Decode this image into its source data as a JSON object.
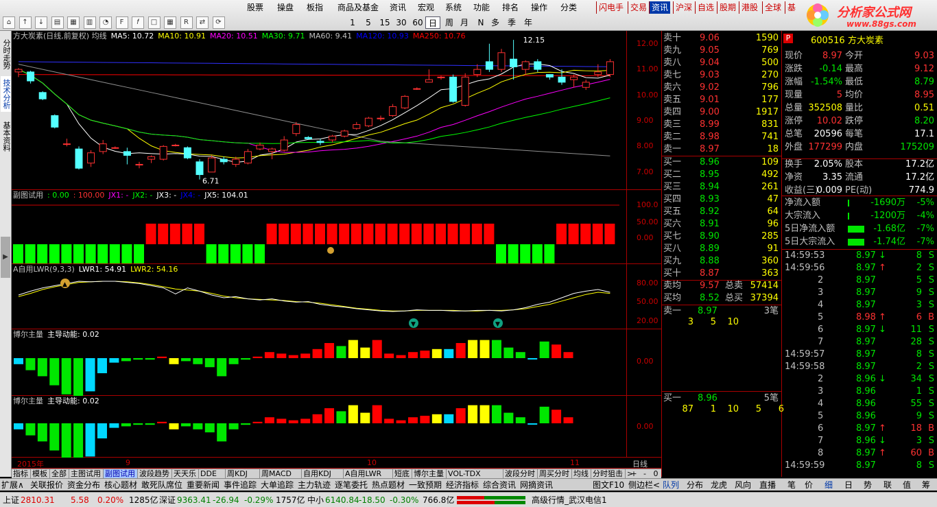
{
  "menu": [
    "股票",
    "操盘",
    "板指",
    "商品及基金",
    "资讯",
    "宏观",
    "系统",
    "功能",
    "排名",
    "操作",
    "分类"
  ],
  "periods": [
    "1",
    "5",
    "15",
    "30",
    "60",
    "日",
    "周",
    "月",
    "N",
    "多",
    "季",
    "年"
  ],
  "active_period": "日",
  "top_right_menu": [
    "闪电手",
    "交易",
    "资讯",
    "沪深",
    "自选",
    "股期",
    "港股",
    "全球",
    "基"
  ],
  "top_right_highlight": "资讯",
  "logo": {
    "title": "分析家公式网",
    "url": "www.88gs.com"
  },
  "left_tabs": [
    "分时走势",
    "技术分析",
    "基本资料"
  ],
  "main_panel": {
    "header": "方大炭素(日线,前复权) 均线",
    "ma": [
      {
        "label": "MA5: 10.72",
        "color": "#ffffff"
      },
      {
        "label": "MA10: 10.91",
        "color": "#ffff00"
      },
      {
        "label": "MA20: 10.51",
        "color": "#ff00ff"
      },
      {
        "label": "MA30: 9.71",
        "color": "#00ff00"
      },
      {
        "label": "MA60: 9.41",
        "color": "#c0c0c0"
      },
      {
        "label": "MA120: 10.93",
        "color": "#0000ff"
      },
      {
        "label": "MA250: 10.76",
        "color": "#ff0000"
      }
    ],
    "y_ticks": [
      "12.00",
      "11.00",
      "10.00",
      "9.00",
      "8.00",
      "7.00"
    ],
    "high_label": "12.15",
    "low_label": "6.71"
  },
  "sub1": {
    "header": "副图试用",
    "vals": [
      {
        "t": ": 0.00",
        "c": "#00ff00"
      },
      {
        "t": ": 100.00",
        "c": "#ff3232"
      },
      {
        "t": "JX1: -",
        "c": "#ff00ff"
      },
      {
        "t": "JX2: -",
        "c": "#00ff00"
      },
      {
        "t": "JX3: -",
        "c": "#ffffff"
      },
      {
        "t": "JX4: -",
        "c": "#0000ff"
      },
      {
        "t": "JX5: 104.01",
        "c": "#ffffff"
      }
    ],
    "y_ticks": [
      "100.0",
      "50.00",
      "0.00"
    ]
  },
  "sub2": {
    "header": "A自用LWR(9,3,3)",
    "vals": [
      {
        "t": "LWR1: 54.91",
        "c": "#ffffff"
      },
      {
        "t": "LWR2: 54.16",
        "c": "#ffff00"
      }
    ],
    "y_ticks": [
      "80.00",
      "50.00",
      "20.00"
    ]
  },
  "sub3": {
    "header": "博尔主量",
    "vals": [
      {
        "t": "主导动能: 0.02",
        "c": "#ffffff"
      }
    ],
    "y_ticks": [
      "0.00"
    ]
  },
  "sub4": {
    "header": "博尔主量",
    "vals": [
      {
        "t": "主导动能: 0.02",
        "c": "#ffffff"
      }
    ],
    "y_ticks": [
      "0.00"
    ]
  },
  "x_axis": {
    "labels": [
      "2015年",
      "9",
      "10",
      "11"
    ],
    "right": "日线"
  },
  "bottom_tabs": [
    "指标",
    "模板",
    "全部",
    "主图试用",
    "副图试用",
    "波段趋势",
    "天天乐",
    "DDE",
    "周KDJ",
    "周MACD",
    "自用KDJ",
    "A自用LWR",
    "短底",
    "博尔主量",
    "VOL-TDX",
    "波段分时",
    "周买分时",
    "均线",
    "分时狙击"
  ],
  "bottom_tab_active": "副图试用",
  "zoom": [
    "+",
    "-",
    "0"
  ],
  "orderbook": {
    "sells": [
      {
        "l": "卖十",
        "p": "9.06",
        "v": "1590"
      },
      {
        "l": "卖九",
        "p": "9.05",
        "v": "769"
      },
      {
        "l": "卖八",
        "p": "9.04",
        "v": "500"
      },
      {
        "l": "卖七",
        "p": "9.03",
        "v": "270"
      },
      {
        "l": "卖六",
        "p": "9.02",
        "v": "796"
      },
      {
        "l": "卖五",
        "p": "9.01",
        "v": "177"
      },
      {
        "l": "卖四",
        "p": "9.00",
        "v": "1917"
      },
      {
        "l": "卖三",
        "p": "8.99",
        "v": "831"
      },
      {
        "l": "卖二",
        "p": "8.98",
        "v": "741"
      },
      {
        "l": "卖一",
        "p": "8.97",
        "v": "18"
      }
    ],
    "buys": [
      {
        "l": "买一",
        "p": "8.96",
        "v": "109"
      },
      {
        "l": "买二",
        "p": "8.95",
        "v": "492"
      },
      {
        "l": "买三",
        "p": "8.94",
        "v": "261"
      },
      {
        "l": "买四",
        "p": "8.93",
        "v": "47"
      },
      {
        "l": "买五",
        "p": "8.92",
        "v": "64"
      },
      {
        "l": "买六",
        "p": "8.91",
        "v": "96"
      },
      {
        "l": "买七",
        "p": "8.90",
        "v": "285"
      },
      {
        "l": "买八",
        "p": "8.89",
        "v": "91"
      },
      {
        "l": "买九",
        "p": "8.88",
        "v": "360"
      },
      {
        "l": "买十",
        "p": "8.87",
        "v": "363"
      }
    ],
    "avg_sell": {
      "l": "卖均",
      "p": "9.57",
      "tl": "总卖",
      "tv": "57414"
    },
    "avg_buy": {
      "l": "买均",
      "p": "8.52",
      "tl": "总买",
      "tv": "37394"
    },
    "queue_sell": {
      "l": "卖一",
      "p": "8.97",
      "n": "3笔",
      "items": [
        "3",
        "5",
        "10"
      ]
    },
    "queue_buy": {
      "l": "买一",
      "p": "8.96",
      "n": "5笔",
      "items": [
        "87",
        "1",
        "10",
        "5",
        "6"
      ]
    }
  },
  "quote": {
    "code": "600516",
    "name": "方大炭素",
    "rows": [
      {
        "a": "现价",
        "av": "8.97",
        "ac": "#ff3232",
        "b": "今开",
        "bv": "9.03",
        "bc": "#ff3232"
      },
      {
        "a": "涨跌",
        "av": "-0.14",
        "ac": "#00e600",
        "b": "最高",
        "bv": "9.12",
        "bc": "#ff3232"
      },
      {
        "a": "涨幅",
        "av": "-1.54%",
        "ac": "#00e600",
        "b": "最低",
        "bv": "8.79",
        "bc": "#00e600"
      },
      {
        "a": "现量",
        "av": "5",
        "ac": "#ff3232",
        "b": "均价",
        "bv": "8.95",
        "bc": "#ff3232"
      },
      {
        "a": "总量",
        "av": "352508",
        "ac": "#ffff00",
        "b": "量比",
        "bv": "0.51",
        "bc": "#ffff00"
      },
      {
        "a": "涨停",
        "av": "10.02",
        "ac": "#ff3232",
        "b": "跌停",
        "bv": "8.20",
        "bc": "#00e600"
      },
      {
        "a": "总笔",
        "av": "20596",
        "ac": "#ffffff",
        "b": "每笔",
        "bv": "17.1",
        "bc": "#ffffff"
      },
      {
        "a": "外盘",
        "av": "177299",
        "ac": "#ff3232",
        "b": "内盘",
        "bv": "175209",
        "bc": "#00e600"
      },
      {
        "a": "换手",
        "av": "2.05%",
        "ac": "#ffffff",
        "b": "股本",
        "bv": "17.2亿",
        "bc": "#ffffff"
      },
      {
        "a": "净资",
        "av": "3.35",
        "ac": "#ffffff",
        "b": "流通",
        "bv": "17.2亿",
        "bc": "#ffffff"
      },
      {
        "a": "收益(三)",
        "av": "0.009",
        "ac": "#ffffff",
        "b": "PE(动)",
        "bv": "774.9",
        "bc": "#ffffff"
      }
    ],
    "flows": [
      {
        "l": "净流入额",
        "v": "-1690万",
        "p": "-5%",
        "bar": 0.05
      },
      {
        "l": "大宗流入",
        "v": "-1200万",
        "p": "-4%",
        "bar": 0.05
      },
      {
        "l": "5日净流入额",
        "v": "-1.68亿",
        "p": "-7%",
        "bar": 0.7
      },
      {
        "l": "5日大宗流入",
        "v": "-1.74亿",
        "p": "-7%",
        "bar": 0.7
      }
    ]
  },
  "ticks": [
    {
      "t": "14:59:53",
      "p": "8.97",
      "d": "down",
      "v": "8",
      "s": "S"
    },
    {
      "t": "14:59:56",
      "p": "8.97",
      "d": "up",
      "v": "2",
      "s": "S"
    },
    {
      "t": "2",
      "p": "8.97",
      "d": "",
      "v": "5",
      "s": "S"
    },
    {
      "t": "3",
      "p": "8.97",
      "d": "",
      "v": "9",
      "s": "S"
    },
    {
      "t": "4",
      "p": "8.97",
      "d": "",
      "v": "3",
      "s": "S"
    },
    {
      "t": "5",
      "p": "8.98",
      "d": "up",
      "v": "6",
      "s": "B"
    },
    {
      "t": "6",
      "p": "8.97",
      "d": "down",
      "v": "11",
      "s": "S"
    },
    {
      "t": "7",
      "p": "8.97",
      "d": "",
      "v": "28",
      "s": "S"
    },
    {
      "t": "14:59:57",
      "p": "8.97",
      "d": "",
      "v": "8",
      "s": "S"
    },
    {
      "t": "14:59:58",
      "p": "8.97",
      "d": "",
      "v": "2",
      "s": "S"
    },
    {
      "t": "2",
      "p": "8.96",
      "d": "down",
      "v": "34",
      "s": "S"
    },
    {
      "t": "3",
      "p": "8.96",
      "d": "",
      "v": "1",
      "s": "S"
    },
    {
      "t": "4",
      "p": "8.96",
      "d": "",
      "v": "55",
      "s": "S"
    },
    {
      "t": "5",
      "p": "8.96",
      "d": "",
      "v": "9",
      "s": "S"
    },
    {
      "t": "6",
      "p": "8.97",
      "d": "up",
      "v": "18",
      "s": "B"
    },
    {
      "t": "7",
      "p": "8.96",
      "d": "down",
      "v": "3",
      "s": "S"
    },
    {
      "t": "8",
      "p": "8.97",
      "d": "up",
      "v": "60",
      "s": "B"
    },
    {
      "t": "14:59:59",
      "p": "8.97",
      "d": "",
      "v": "8",
      "s": "S"
    }
  ],
  "bar2_left": [
    "扩展∧",
    "关联报价",
    "资金分布",
    "核心题材",
    "敢死队席位",
    "重要新闻",
    "事件追踪",
    "大单追踪",
    "主力轨迹",
    "逐笔委托",
    "热点题材",
    "一致预期",
    "经济指标",
    "综合资讯",
    "网摘资讯"
  ],
  "bar2_mid": [
    "图文F10",
    "侧边栏<"
  ],
  "bar2_right": [
    "队列",
    "分布",
    "龙虎",
    "风向",
    "直播",
    "笔",
    "价",
    "细",
    "日",
    "势",
    "联",
    "值",
    "筹"
  ],
  "status": {
    "sh_label": "上证",
    "sh": "2810.31",
    "sh_chg": "5.58",
    "sh_pct": "0.20%",
    "sh_amt": "1285亿",
    "sz_label": "深证",
    "sz": "9363.41",
    "sz_chg": "-26.94",
    "sz_pct": "-0.29%",
    "sz_amt": "1757亿",
    "zx_label": "中小",
    "zx": "6140.84",
    "zx_chg": "-18.50",
    "zx_pct": "-0.30%",
    "zx_amt": "766.8亿",
    "service": "高级行情_武汉电信1"
  },
  "chart_data": {
    "type": "candlestick",
    "candles": [
      [
        10.9,
        11.0,
        10.7,
        11.05
      ],
      [
        10.9,
        10.55,
        10.45,
        10.95
      ],
      [
        10.1,
        9.85,
        9.8,
        10.15
      ],
      [
        9.2,
        8.75,
        8.7,
        9.25
      ],
      [
        8.1,
        8.1,
        8.0,
        8.3
      ],
      [
        7.9,
        7.15,
        7.1,
        8.0
      ],
      [
        7.35,
        7.75,
        7.2,
        7.85
      ],
      [
        7.8,
        8.1,
        7.7,
        8.25
      ],
      [
        7.95,
        7.95,
        7.9,
        8.0
      ],
      [
        7.8,
        7.65,
        7.3,
        7.95
      ],
      [
        7.3,
        7.3,
        7.15,
        7.4
      ],
      [
        7.5,
        7.6,
        7.35,
        7.65
      ],
      [
        7.5,
        8.0,
        7.45,
        8.05
      ],
      [
        8.05,
        8.05,
        8.0,
        8.1
      ],
      [
        7.95,
        7.55,
        7.5,
        8.0
      ],
      [
        7.4,
        6.9,
        6.71,
        7.5
      ],
      [
        7.0,
        7.55,
        7.0,
        7.65
      ],
      [
        7.5,
        7.4,
        7.3,
        7.6
      ],
      [
        7.3,
        7.5,
        7.2,
        7.6
      ],
      [
        7.35,
        7.8,
        7.3,
        7.9
      ],
      [
        7.9,
        8.05,
        7.85,
        8.15
      ],
      [
        7.8,
        7.9,
        7.5,
        7.95
      ],
      [
        7.85,
        8.25,
        7.8,
        8.4
      ],
      [
        8.5,
        8.85,
        8.4,
        8.95
      ],
      [
        8.35,
        8.3,
        8.25,
        8.4
      ],
      [
        8.2,
        8.15,
        8.05,
        8.3
      ],
      [
        8.25,
        8.4,
        8.15,
        8.45
      ],
      [
        8.4,
        8.6,
        8.35,
        8.65
      ],
      [
        8.7,
        8.85,
        8.65,
        8.95
      ],
      [
        8.8,
        9.1,
        8.75,
        9.15
      ],
      [
        9.1,
        9.1,
        9.0,
        9.2
      ],
      [
        9.2,
        9.55,
        9.15,
        9.65
      ],
      [
        9.5,
        9.95,
        9.45,
        10.0
      ],
      [
        10.25,
        10.25,
        10.2,
        10.3
      ],
      [
        10.5,
        10.6,
        10.5,
        11.0
      ],
      [
        10.7,
        10.7,
        10.6,
        10.75
      ],
      [
        10.7,
        9.75,
        9.7,
        10.8
      ],
      [
        9.6,
        10.7,
        9.55,
        10.85
      ],
      [
        10.8,
        11.0,
        10.7,
        11.2
      ],
      [
        11.3,
        11.0,
        10.9,
        12.0
      ],
      [
        11.0,
        11.65,
        10.9,
        11.8
      ],
      [
        11.4,
        11.1,
        10.6,
        12.15
      ],
      [
        11.0,
        11.3,
        10.8,
        11.35
      ],
      [
        11.3,
        11.0,
        10.9,
        11.4
      ],
      [
        10.8,
        10.7,
        10.6,
        10.8
      ],
      [
        10.7,
        10.5,
        10.4,
        11.0
      ],
      [
        10.6,
        10.7,
        10.3,
        10.8
      ],
      [
        10.3,
        10.5,
        10.2,
        10.6
      ],
      [
        10.8,
        10.9,
        10.7,
        11.2
      ],
      [
        10.8,
        11.3,
        10.7,
        11.4
      ]
    ],
    "ylim": [
      6.3,
      12.5
    ],
    "y_ticks": [
      12,
      11,
      10,
      9,
      8,
      7
    ],
    "sub1_bars": [
      0,
      0,
      0,
      0,
      0,
      0,
      0,
      0,
      0,
      0,
      0,
      100,
      100,
      100,
      100,
      100,
      0,
      0,
      0,
      0,
      0,
      100,
      100,
      100,
      100,
      100,
      100,
      100,
      100,
      100,
      100,
      100,
      100,
      100,
      100,
      100,
      100,
      100,
      100,
      100,
      0,
      0,
      0,
      0,
      0,
      100,
      100,
      100,
      100,
      100
    ],
    "lwr1": [
      55,
      62,
      68,
      72,
      76,
      80,
      79,
      80,
      80,
      78,
      76,
      72,
      68,
      57,
      68,
      62,
      55,
      50,
      52,
      48,
      46,
      48,
      44,
      42,
      43,
      38,
      35,
      33,
      30,
      28,
      26,
      25,
      26,
      28,
      27,
      27,
      26,
      26,
      27,
      27,
      26,
      28,
      32,
      38,
      42,
      50,
      58,
      62,
      65,
      60
    ],
    "lwr2": [
      52,
      58,
      65,
      70,
      74,
      78,
      79,
      80,
      80,
      79,
      77,
      74,
      70,
      66,
      64,
      62,
      58,
      53,
      50,
      48,
      47,
      46,
      45,
      43,
      42,
      40,
      37,
      34,
      31,
      29,
      27,
      26,
      26,
      27,
      27,
      27,
      27,
      26,
      26,
      27,
      27,
      28,
      30,
      34,
      38,
      44,
      50,
      56,
      60,
      58
    ],
    "mom": [
      -4,
      -8,
      -12,
      -18,
      -24,
      -26,
      -22,
      -10,
      -3,
      -2,
      -1,
      -1,
      1,
      -4,
      -2,
      -4,
      -6,
      -12,
      -4,
      -1,
      1,
      4,
      3,
      2,
      3,
      6,
      10,
      8,
      12,
      7,
      12,
      3,
      2,
      4,
      5,
      6,
      6,
      10,
      12,
      12,
      12,
      7,
      4,
      0,
      11,
      9,
      4,
      1,
      -1,
      -2,
      -4,
      -4,
      -2,
      3,
      5
    ],
    "mom_colors": [
      "#00d8ff",
      "#00e600",
      "#00e600",
      "#00e600",
      "#00e600",
      "#00e600",
      "#00d8ff",
      "#00d8ff",
      "#00d8ff",
      "#00e600",
      "#00e600",
      "#00e600",
      "#ff0000",
      "#ffff00",
      "#00e600",
      "#00e600",
      "#00e600",
      "#00e600",
      "#00e600",
      "#00e600",
      "#ff0000",
      "#ff0000",
      "#ff0000",
      "#ff0000",
      "#ff0000",
      "#ff0000",
      "#ff0000",
      "#00e600",
      "#ffff00",
      "#ffff00",
      "#ff0000",
      "#ff0000",
      "#ff0000",
      "#ff0000",
      "#ff0000",
      "#ffff00",
      "#00d8ff",
      "#ff0000",
      "#ffff00",
      "#ffff00",
      "#00e600",
      "#00e600",
      "#00e600",
      "#00d8ff",
      "#00e600",
      "#ff0000",
      "#ff0000"
    ]
  }
}
